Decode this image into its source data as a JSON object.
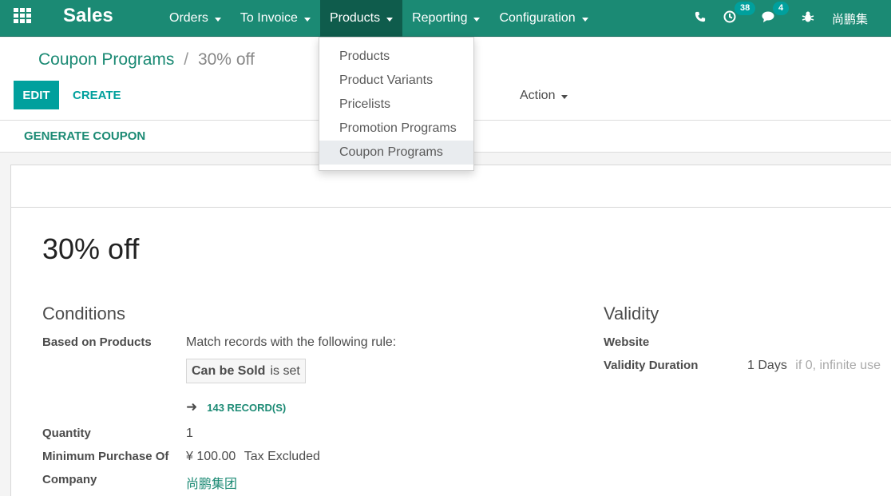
{
  "navbar": {
    "app_name": "Sales",
    "menu": [
      {
        "label": "Orders"
      },
      {
        "label": "To Invoice"
      },
      {
        "label": "Products"
      },
      {
        "label": "Reporting"
      },
      {
        "label": "Configuration"
      }
    ],
    "activity_count": "38",
    "message_count": "4",
    "user": "尚鹏集"
  },
  "products_dropdown": {
    "items": [
      "Products",
      "Product Variants",
      "Pricelists",
      "Promotion Programs",
      "Coupon Programs"
    ],
    "active_item": "Coupon Programs"
  },
  "breadcrumb": {
    "parent": "Coupon Programs",
    "separator": "/",
    "current": "30% off"
  },
  "buttons": {
    "edit": "EDIT",
    "create": "CREATE",
    "action": "Action",
    "generate_coupon": "GENERATE COUPON"
  },
  "form": {
    "title": "30% off",
    "conditions": {
      "heading": "Conditions",
      "based_on_products_label": "Based on Products",
      "rule_text": "Match records with the following rule:",
      "rule_field": "Can be Sold",
      "rule_operator": "is set",
      "records_link": "143 RECORD(S)",
      "quantity_label": "Quantity",
      "quantity_value": "1",
      "min_purchase_label": "Minimum Purchase Of",
      "min_purchase_value": "¥ 100.00",
      "tax_option": "Tax Excluded",
      "company_label": "Company",
      "company_value": "尚鹏集团"
    },
    "validity": {
      "heading": "Validity",
      "website_label": "Website",
      "duration_label": "Validity Duration",
      "duration_value": "1",
      "duration_unit": "Days",
      "duration_hint": "if 0, infinite use"
    }
  },
  "colors": {
    "navbar": "#1b8a74",
    "navbar_active": "#0f5c4c",
    "primary": "#00a09d",
    "link": "#1b8a74"
  }
}
